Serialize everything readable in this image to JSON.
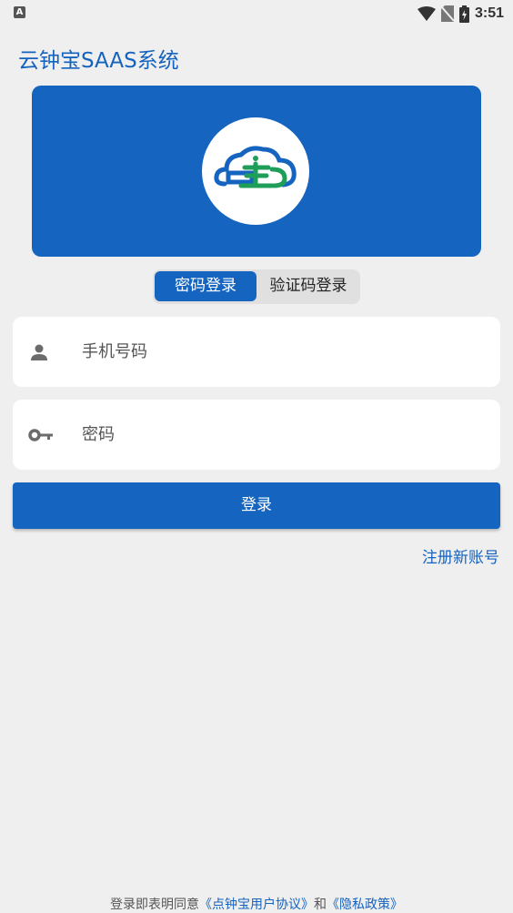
{
  "status_bar": {
    "notification_letter": "A",
    "time": "3:51",
    "icons": [
      "wifi-icon",
      "no-sim-icon",
      "battery-charging-icon"
    ]
  },
  "header": {
    "title": "云钟宝SAAS系统"
  },
  "banner": {
    "logo": "cloud-clock-logo"
  },
  "login_tabs": {
    "password_tab": "密码登录",
    "code_tab": "验证码登录",
    "active": "password_tab"
  },
  "form": {
    "phone_placeholder": "手机号码",
    "password_placeholder": "密码",
    "phone_icon": "person-icon",
    "password_icon": "key-icon"
  },
  "actions": {
    "login_label": "登录",
    "register_label": "注册新账号"
  },
  "footer": {
    "prefix": "登录即表明同意",
    "user_agreement": "《点钟宝用户协议》",
    "conjunction": "和",
    "privacy_policy": "《隐私政策》"
  },
  "colors": {
    "primary": "#1565c0",
    "background": "#efefef",
    "logo_green": "#1f9e5a"
  }
}
